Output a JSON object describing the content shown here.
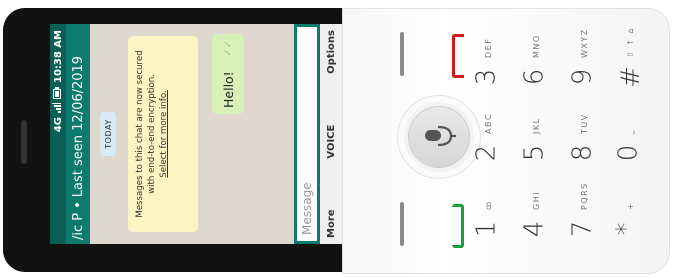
{
  "status": {
    "network": "4G",
    "signal_icon": "signal-bars-icon",
    "battery_icon": "battery-icon",
    "time": "10:38 AM"
  },
  "title": {
    "contact": "/ic P",
    "separator": "•",
    "last_seen": "Last seen 12/06/2019"
  },
  "chat": {
    "date_chip": "TODAY",
    "system_message": "Messages to this chat are now secured with end-to-end encryption.",
    "system_link": "Select for more info.",
    "message": {
      "text": "Hello!",
      "status_icon": "double-check-icon"
    }
  },
  "composer": {
    "placeholder": "Message"
  },
  "softkeys": {
    "left": "More",
    "center": "VOICE",
    "right": "Options"
  },
  "keypad": {
    "keys": [
      {
        "digit": "1",
        "letters": "ꝏ"
      },
      {
        "digit": "2",
        "letters": "ABC"
      },
      {
        "digit": "3",
        "letters": "DEF"
      },
      {
        "digit": "4",
        "letters": "GHI"
      },
      {
        "digit": "5",
        "letters": "JKL"
      },
      {
        "digit": "6",
        "letters": "MNO"
      },
      {
        "digit": "7",
        "letters": "PQRS"
      },
      {
        "digit": "8",
        "letters": "TUV"
      },
      {
        "digit": "9",
        "letters": "WXYZ"
      },
      {
        "digit": "*",
        "letters": "+"
      },
      {
        "digit": "0",
        "letters": "⎵"
      },
      {
        "digit": "#",
        "letters": "⇧ ↑ ⌂"
      }
    ],
    "nav_icon": "microphone-icon",
    "call_key_color": "#1a9e3a",
    "end_key_color": "#d11a1a"
  },
  "colors": {
    "header": "#0c7a6c",
    "statusbar": "#0b5e55",
    "sent_bubble": "#d7f1b8",
    "system_bubble": "#fdf6c4"
  }
}
